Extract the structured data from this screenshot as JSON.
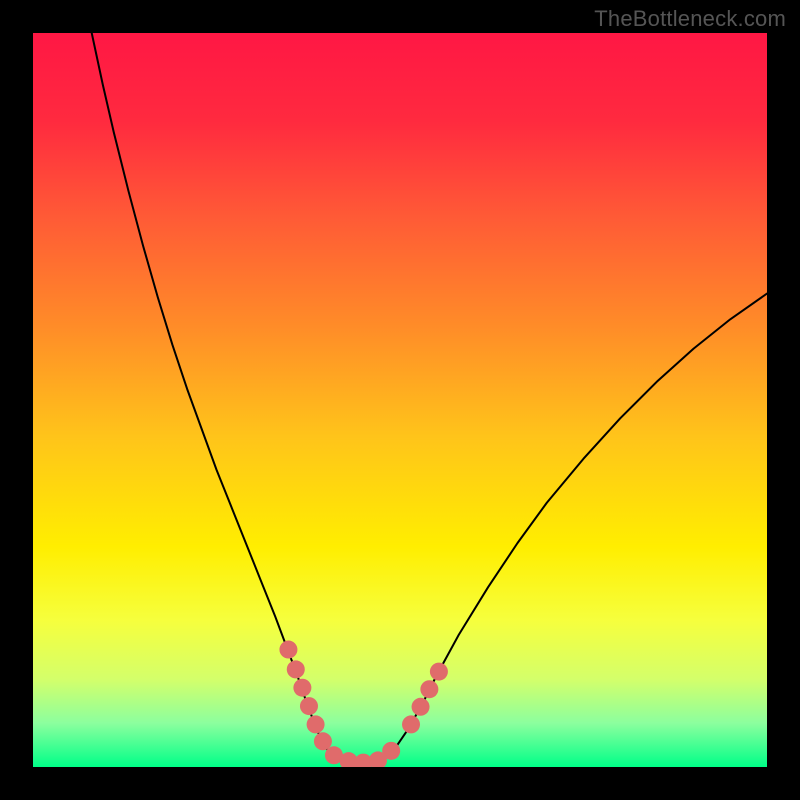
{
  "watermark": "TheBottleneck.com",
  "chart_data": {
    "type": "line",
    "title": "",
    "xlabel": "",
    "ylabel": "",
    "xlim": [
      0,
      100
    ],
    "ylim": [
      0,
      100
    ],
    "gradient_stops": [
      {
        "offset": 0,
        "color": "#ff1744"
      },
      {
        "offset": 12,
        "color": "#ff2a3f"
      },
      {
        "offset": 25,
        "color": "#ff5a36"
      },
      {
        "offset": 40,
        "color": "#ff8c28"
      },
      {
        "offset": 55,
        "color": "#ffc41a"
      },
      {
        "offset": 70,
        "color": "#ffee00"
      },
      {
        "offset": 80,
        "color": "#f6ff3d"
      },
      {
        "offset": 88,
        "color": "#d4ff6a"
      },
      {
        "offset": 94,
        "color": "#8cff9e"
      },
      {
        "offset": 100,
        "color": "#00ff88"
      }
    ],
    "series": [
      {
        "name": "curve",
        "stroke": "#000000",
        "stroke_width": 2,
        "points": [
          {
            "x": 8.0,
            "y": 100.0
          },
          {
            "x": 9.5,
            "y": 93.0
          },
          {
            "x": 11.0,
            "y": 86.5
          },
          {
            "x": 13.0,
            "y": 78.5
          },
          {
            "x": 15.0,
            "y": 71.0
          },
          {
            "x": 17.0,
            "y": 64.0
          },
          {
            "x": 19.0,
            "y": 57.5
          },
          {
            "x": 21.0,
            "y": 51.5
          },
          {
            "x": 23.0,
            "y": 46.0
          },
          {
            "x": 25.0,
            "y": 40.5
          },
          {
            "x": 27.0,
            "y": 35.5
          },
          {
            "x": 29.0,
            "y": 30.5
          },
          {
            "x": 31.0,
            "y": 25.5
          },
          {
            "x": 33.0,
            "y": 20.5
          },
          {
            "x": 34.5,
            "y": 16.5
          },
          {
            "x": 36.0,
            "y": 12.5
          },
          {
            "x": 37.2,
            "y": 9.0
          },
          {
            "x": 38.5,
            "y": 5.5
          },
          {
            "x": 39.5,
            "y": 3.2
          },
          {
            "x": 40.5,
            "y": 1.8
          },
          {
            "x": 42.0,
            "y": 0.9
          },
          {
            "x": 44.0,
            "y": 0.5
          },
          {
            "x": 46.0,
            "y": 0.5
          },
          {
            "x": 48.0,
            "y": 1.2
          },
          {
            "x": 49.5,
            "y": 2.8
          },
          {
            "x": 51.0,
            "y": 5.0
          },
          {
            "x": 53.0,
            "y": 8.5
          },
          {
            "x": 55.0,
            "y": 12.5
          },
          {
            "x": 58.0,
            "y": 18.0
          },
          {
            "x": 62.0,
            "y": 24.5
          },
          {
            "x": 66.0,
            "y": 30.5
          },
          {
            "x": 70.0,
            "y": 36.0
          },
          {
            "x": 75.0,
            "y": 42.0
          },
          {
            "x": 80.0,
            "y": 47.5
          },
          {
            "x": 85.0,
            "y": 52.5
          },
          {
            "x": 90.0,
            "y": 57.0
          },
          {
            "x": 95.0,
            "y": 61.0
          },
          {
            "x": 100.0,
            "y": 64.5
          }
        ]
      }
    ],
    "markers": {
      "color": "#e06b6b",
      "radius": 9,
      "groups": [
        {
          "name": "left-cluster",
          "points": [
            {
              "x": 34.8,
              "y": 16.0
            },
            {
              "x": 35.8,
              "y": 13.3
            },
            {
              "x": 36.7,
              "y": 10.8
            },
            {
              "x": 37.6,
              "y": 8.3
            },
            {
              "x": 38.5,
              "y": 5.8
            },
            {
              "x": 39.5,
              "y": 3.5
            },
            {
              "x": 41.0,
              "y": 1.6
            },
            {
              "x": 43.0,
              "y": 0.8
            },
            {
              "x": 45.0,
              "y": 0.6
            },
            {
              "x": 47.0,
              "y": 0.9
            },
            {
              "x": 48.8,
              "y": 2.2
            }
          ]
        },
        {
          "name": "right-cluster",
          "points": [
            {
              "x": 51.5,
              "y": 5.8
            },
            {
              "x": 52.8,
              "y": 8.2
            },
            {
              "x": 54.0,
              "y": 10.6
            },
            {
              "x": 55.3,
              "y": 13.0
            }
          ]
        }
      ]
    }
  }
}
